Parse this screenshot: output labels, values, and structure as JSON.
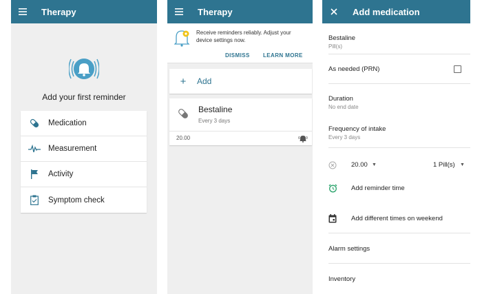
{
  "colors": {
    "primary": "#2e7490",
    "bell": "#4a9fc6",
    "background": "#efefef"
  },
  "screen1": {
    "title": "Therapy",
    "heading": "Add your first reminder",
    "options": [
      {
        "label": "Medication",
        "icon": "pill-icon"
      },
      {
        "label": "Measurement",
        "icon": "pulse-icon"
      },
      {
        "label": "Activity",
        "icon": "flag-icon"
      },
      {
        "label": "Symptom check",
        "icon": "clipboard-icon"
      }
    ]
  },
  "screen2": {
    "title": "Therapy",
    "banner_text": "Receive reminders reliably. Adjust your device settings now.",
    "dismiss": "DISMISS",
    "learn_more": "LEARN MORE",
    "add_label": "Add",
    "medication": {
      "name": "Bestaline",
      "schedule": "Every 3 days",
      "time": "20.00"
    }
  },
  "screen3": {
    "title": "Add medication",
    "med_name": "Bestaline",
    "med_unit": "Pill(s)",
    "as_needed": "As needed (PRN)",
    "duration_label": "Duration",
    "duration_value": "No end date",
    "frequency_label": "Frequency of intake",
    "frequency_value": "Every 3 days",
    "dose_time": "20.00",
    "dose_amount": "1 Pill(s)",
    "add_reminder_time": "Add reminder time",
    "weekend_times": "Add different times on weekend",
    "alarm_settings": "Alarm settings",
    "inventory": "Inventory"
  }
}
